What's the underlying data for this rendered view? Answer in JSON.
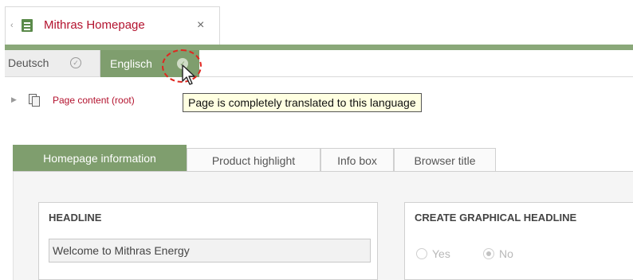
{
  "document_tab": {
    "title": "Mithras Homepage",
    "close_glyph": "×",
    "chevron": "‹"
  },
  "languages": [
    {
      "label": "Deutsch",
      "check": "✓"
    },
    {
      "label": "Englisch",
      "check": "✓"
    }
  ],
  "tree": {
    "label": "Page content (root)"
  },
  "tooltip": {
    "text": "Page is completely translated to this language"
  },
  "tabs": [
    {
      "label": "Homepage information"
    },
    {
      "label": "Product highlight"
    },
    {
      "label": "Info box"
    },
    {
      "label": "Browser title"
    }
  ],
  "headline": {
    "heading": "HEADLINE",
    "value": "Welcome to Mithras Energy"
  },
  "graphical": {
    "heading": "CREATE GRAPHICAL HEADLINE",
    "options": [
      {
        "label": "Yes"
      },
      {
        "label": "No"
      }
    ],
    "selected": "No"
  },
  "colors": {
    "accent_green": "#7f9e6e",
    "title_red": "#b3122e",
    "tooltip_bg": "#ffffe1"
  }
}
